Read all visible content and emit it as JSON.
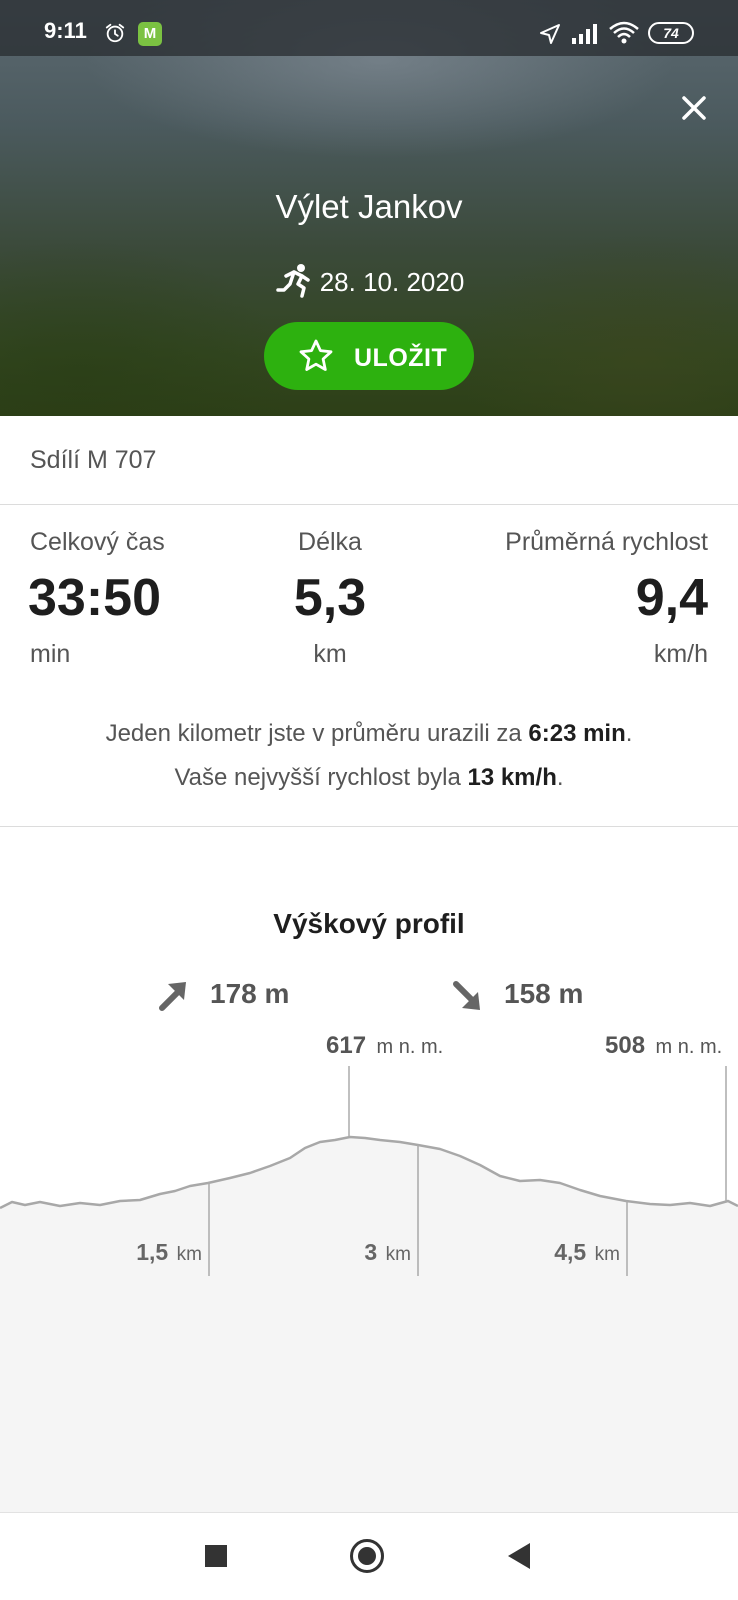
{
  "status_bar": {
    "time": "9:11",
    "app_badge": "M",
    "battery": "74"
  },
  "header": {
    "title": "Výlet Jankov",
    "date": "28. 10. 2020",
    "activity_icon": "running-person-icon",
    "save_label": "ULOŽIT",
    "close_icon": "close-icon"
  },
  "shared_by": "Sdílí M 707",
  "stats": {
    "total_time": {
      "label": "Celkový čas",
      "value": "33:50",
      "unit": "min"
    },
    "length": {
      "label": "Délka",
      "value": "5,3",
      "unit": "km"
    },
    "avg_speed": {
      "label": "Průměrná rychlost",
      "value": "9,4",
      "unit": "km/h"
    }
  },
  "summary": {
    "line1_prefix": "Jeden kilometr jste v průměru urazili za ",
    "line1_value": "6:23 min",
    "line1_suffix": ".",
    "line2_prefix": "Vaše nejvyšší rychlost byla ",
    "line2_value": "13 km/h",
    "line2_suffix": "."
  },
  "elevation": {
    "title": "Výškový profil",
    "ascent": "178 m",
    "descent": "158 m",
    "max_value": "617",
    "max_unit": "m n. m.",
    "end_value": "508",
    "end_unit": "m n. m.",
    "km_marks": [
      {
        "value": "1,5",
        "unit": "km"
      },
      {
        "value": "3",
        "unit": "km"
      },
      {
        "value": "4,5",
        "unit": "km"
      }
    ],
    "colors": {
      "line": "#a8a8a8",
      "fill": "#f5f5f5",
      "accent": "#2db10f"
    }
  }
}
